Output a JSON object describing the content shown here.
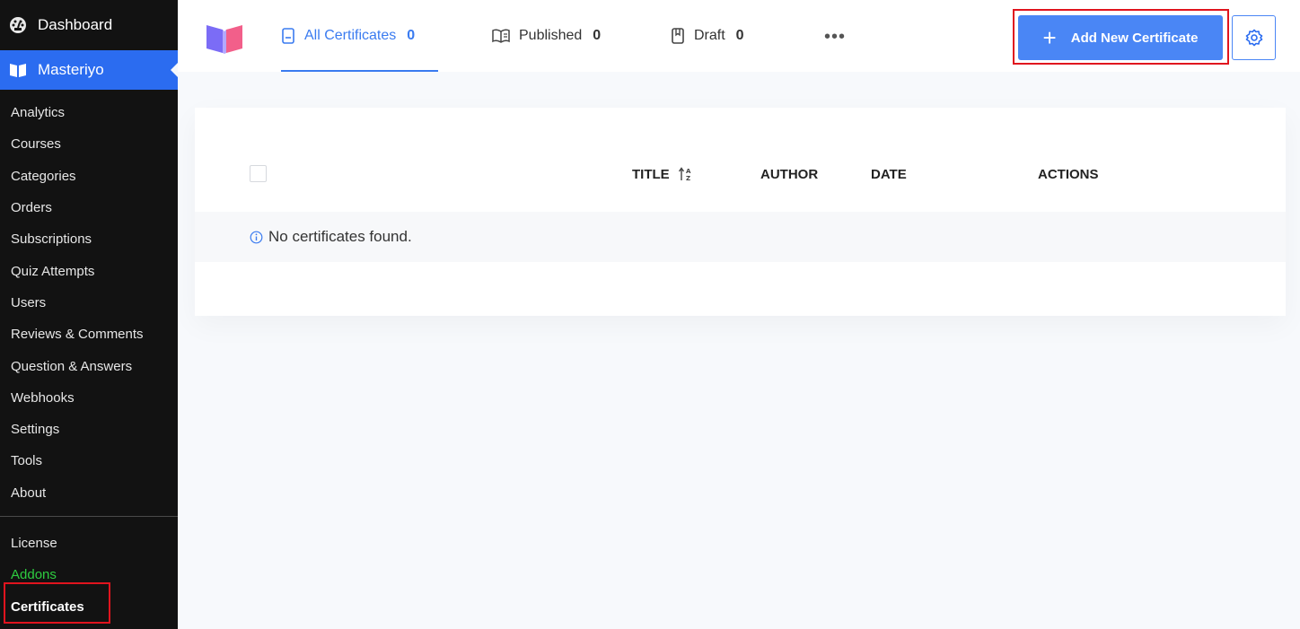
{
  "sidebar": {
    "dashboard_label": "Dashboard",
    "current_label": "Masteriyo",
    "items": [
      {
        "label": "Analytics"
      },
      {
        "label": "Courses"
      },
      {
        "label": "Categories"
      },
      {
        "label": "Orders"
      },
      {
        "label": "Subscriptions"
      },
      {
        "label": "Quiz Attempts"
      },
      {
        "label": "Users"
      },
      {
        "label": "Reviews & Comments"
      },
      {
        "label": "Question & Answers"
      },
      {
        "label": "Webhooks"
      },
      {
        "label": "Settings"
      },
      {
        "label": "Tools"
      },
      {
        "label": "About"
      }
    ],
    "bottom_items": [
      {
        "label": "License"
      },
      {
        "label": "Addons"
      },
      {
        "label": "Certificates"
      }
    ]
  },
  "header": {
    "tabs": [
      {
        "label": "All Certificates",
        "count": "0",
        "icon": "document-icon"
      },
      {
        "label": "Published",
        "count": "0",
        "icon": "book-open-icon"
      },
      {
        "label": "Draft",
        "count": "0",
        "icon": "bookmark-book-icon"
      }
    ],
    "more_label": "•••",
    "add_button_label": "Add New Certificate",
    "add_button_icon": "plus-icon",
    "settings_icon": "gear-icon"
  },
  "table": {
    "columns": {
      "title": "TITLE",
      "author": "AUTHOR",
      "date": "DATE",
      "actions": "ACTIONS"
    },
    "empty_message": "No certificates found."
  },
  "colors": {
    "accent": "#3a7bf0",
    "button": "#4a86f5",
    "sidebar_bg": "#121212",
    "sidebar_active": "#2b6cf0",
    "addons_green": "#2ecc40",
    "highlight_red": "#e0141e"
  }
}
